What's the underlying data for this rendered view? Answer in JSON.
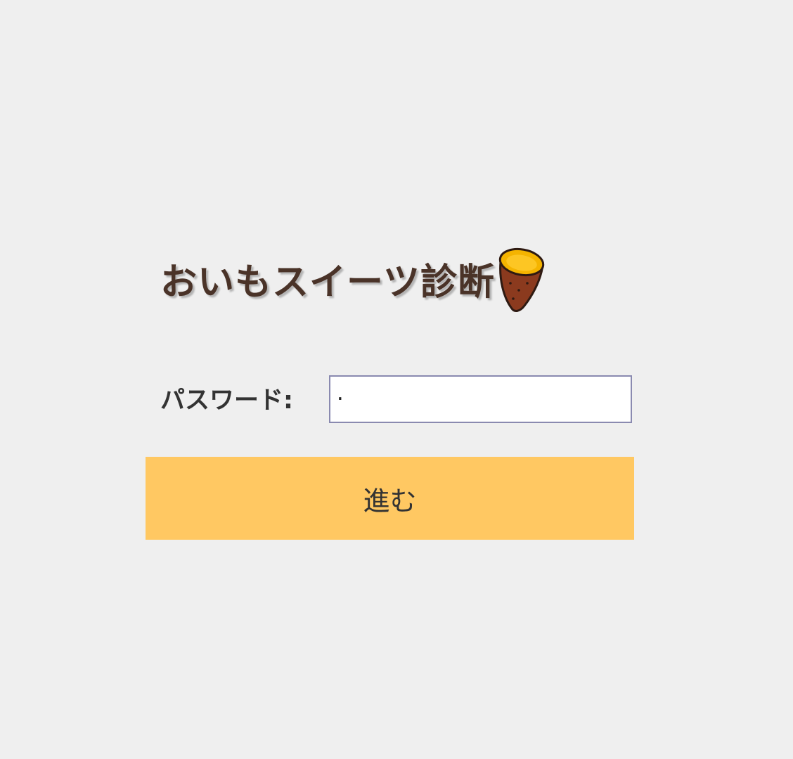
{
  "header": {
    "title": "おいもスイーツ診断",
    "title_icon": "sweet-potato-icon"
  },
  "form": {
    "password_label": "パスワード:",
    "password_value": "·"
  },
  "actions": {
    "submit_label": "進む"
  },
  "colors": {
    "background": "#efefef",
    "title": "#4a3328",
    "button": "#ffc862",
    "input_border": "#8a8ab0",
    "potato_skin": "#8b3a1e",
    "potato_flesh": "#f5b400"
  }
}
